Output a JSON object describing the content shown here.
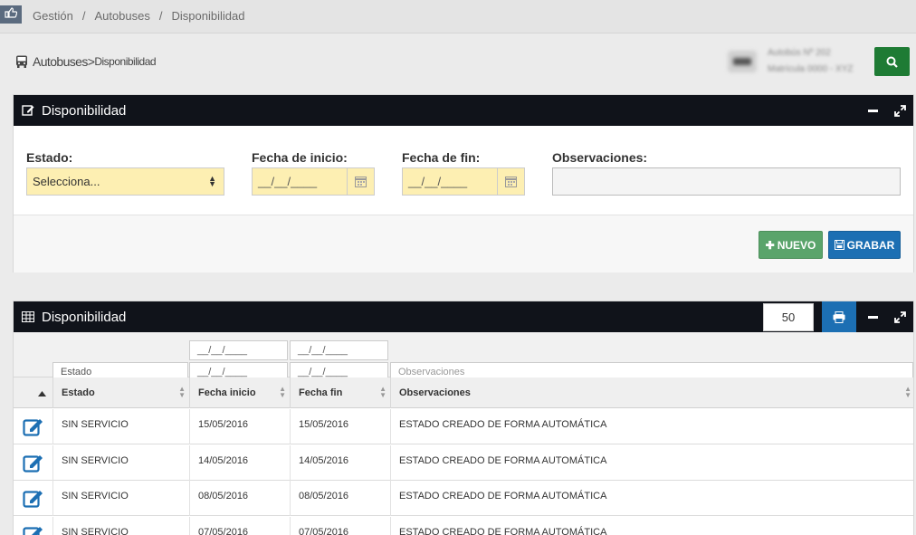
{
  "breadcrumb": [
    "Gestión",
    "Autobuses",
    "Disponibilidad"
  ],
  "subheader": {
    "section": "Autobuses",
    "separator": ">",
    "current": "Disponibilidad"
  },
  "vehicle": {
    "line1": "Autobús Nº 202",
    "line2": "Matrícula 0000 - XYZ"
  },
  "form_panel": {
    "title": "Disponibilidad",
    "labels": {
      "estado": "Estado:",
      "fecha_inicio": "Fecha de inicio:",
      "fecha_fin": "Fecha de fin:",
      "observaciones": "Observaciones:"
    },
    "estado_value": "Selecciona...",
    "fecha_inicio_value": "__/__/____",
    "fecha_fin_value": "__/__/____",
    "buttons": {
      "nuevo": "NUEVO",
      "grabar": "GRABAR"
    }
  },
  "grid_panel": {
    "title": "Disponibilidad",
    "page_size": "50",
    "filters": {
      "inicio_from": "__/__/____",
      "fin_from": "__/__/____",
      "estado": "Estado",
      "inicio_to": "__/__/____",
      "fin_to": "__/__/____",
      "observaciones_placeholder": "Observaciones"
    },
    "columns": [
      "Estado",
      "Fecha inicio",
      "Fecha fin",
      "Observaciones"
    ],
    "rows": [
      {
        "estado": "SIN SERVICIO",
        "inicio": "15/05/2016",
        "fin": "15/05/2016",
        "obs": "ESTADO CREADO DE FORMA AUTOMÁTICA"
      },
      {
        "estado": "SIN SERVICIO",
        "inicio": "14/05/2016",
        "fin": "14/05/2016",
        "obs": "ESTADO CREADO DE FORMA AUTOMÁTICA"
      },
      {
        "estado": "SIN SERVICIO",
        "inicio": "08/05/2016",
        "fin": "08/05/2016",
        "obs": "ESTADO CREADO DE FORMA AUTOMÁTICA"
      },
      {
        "estado": "SIN SERVICIO",
        "inicio": "07/05/2016",
        "fin": "07/05/2016",
        "obs": "ESTADO CREADO DE FORMA AUTOMÁTICA"
      }
    ]
  },
  "colors": {
    "header_dark": "#10131a",
    "field_yellow": "#fdefb2",
    "green": "#5aa46b",
    "blue": "#1c6fb3",
    "search_green": "#1e7b34"
  }
}
